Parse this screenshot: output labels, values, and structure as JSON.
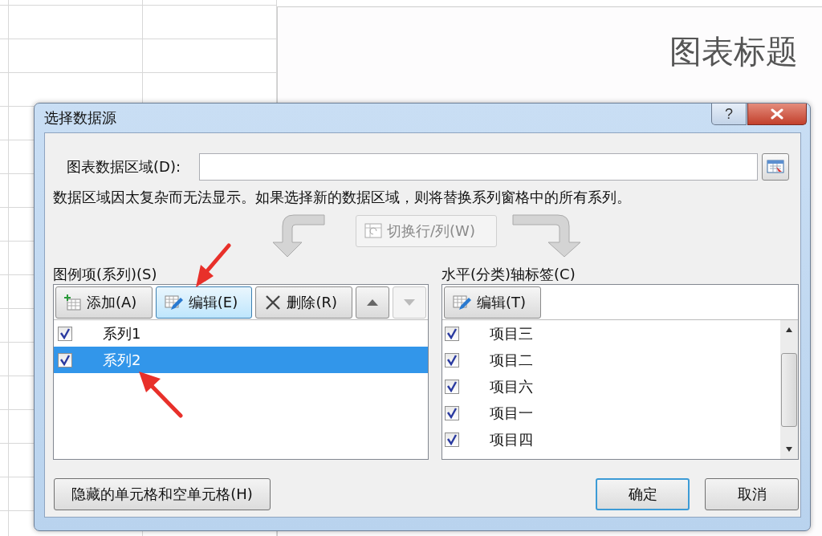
{
  "background": {
    "chart_title": "图表标题"
  },
  "window": {
    "title": "选择数据源",
    "help": "?"
  },
  "data_range": {
    "label": "图表数据区域(D):"
  },
  "message": "数据区域因太复杂而无法显示。如果选择新的数据区域，则将替换系列窗格中的所有系列。",
  "switch_button": {
    "label": "切换行/列(W)",
    "disabled": true
  },
  "legend": {
    "label": "图例项(系列)(S)",
    "buttons": [
      {
        "kind": "add",
        "label": "添加(A)",
        "hovered": false,
        "disabled": false
      },
      {
        "kind": "edit",
        "label": "编辑(E)",
        "hovered": true,
        "disabled": false
      },
      {
        "kind": "delete",
        "label": "删除(R)",
        "hovered": false,
        "disabled": false
      },
      {
        "kind": "up",
        "hovered": false,
        "disabled": false
      },
      {
        "kind": "down",
        "hovered": false,
        "disabled": true
      }
    ],
    "series": [
      {
        "name": "系列1",
        "checked": true,
        "selected": false
      },
      {
        "name": "系列2",
        "checked": true,
        "selected": true
      }
    ]
  },
  "axis": {
    "label": "水平(分类)轴标签(C)",
    "edit_button": "编辑(T)",
    "items": [
      {
        "name": "项目三",
        "checked": true
      },
      {
        "name": "项目二",
        "checked": true
      },
      {
        "name": "项目六",
        "checked": true
      },
      {
        "name": "项目一",
        "checked": true
      },
      {
        "name": "项目四",
        "checked": true
      }
    ]
  },
  "hidden_cells_button": "隐藏的单元格和空单元格(H)",
  "buttons": [
    {
      "label": "确定",
      "default": true
    },
    {
      "label": "取消",
      "default": false
    }
  ]
}
